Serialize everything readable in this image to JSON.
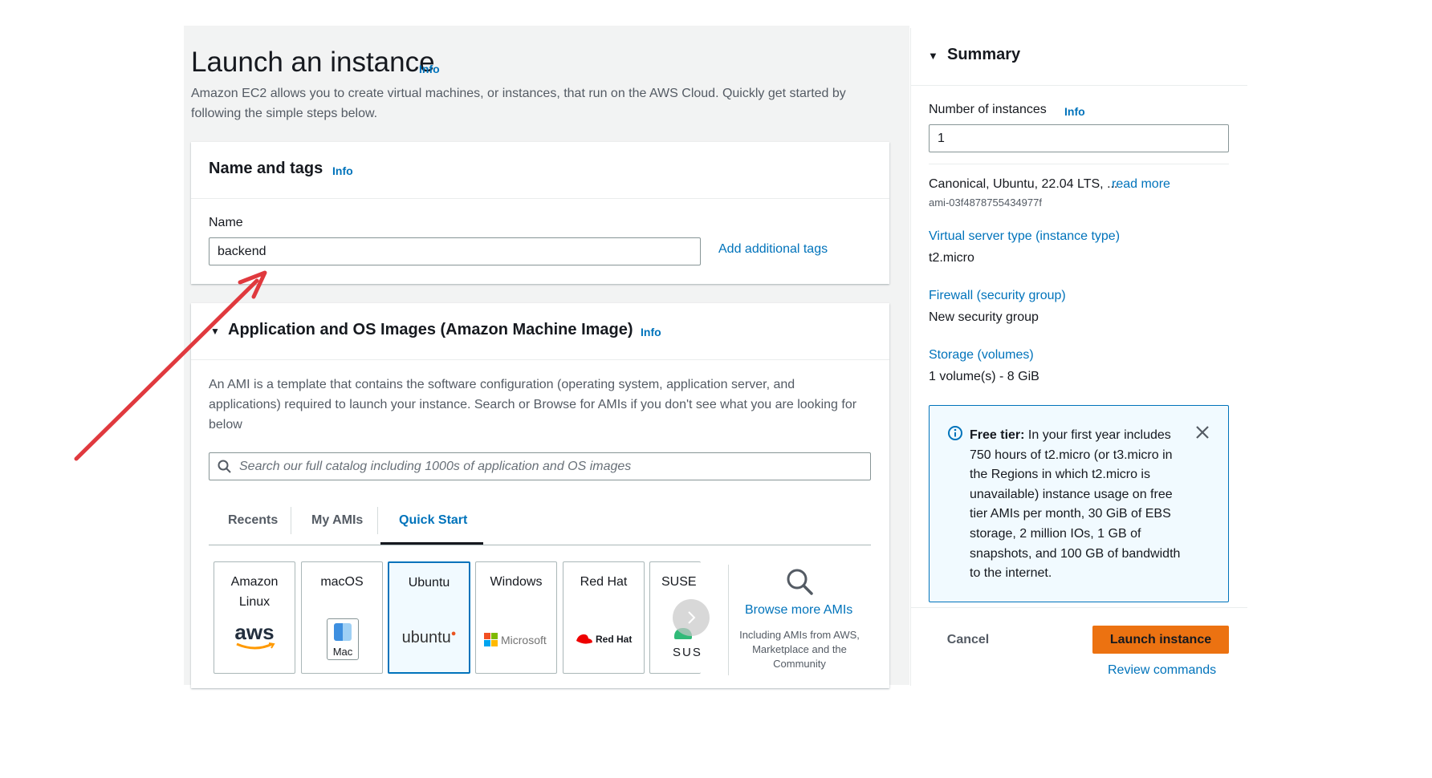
{
  "header": {
    "title": "Launch an instance",
    "info": "Info",
    "description": "Amazon EC2 allows you to create virtual machines, or instances, that run on the AWS Cloud. Quickly get started by following the simple steps below."
  },
  "name_tags": {
    "title": "Name and tags",
    "info": "Info",
    "name_label": "Name",
    "name_value": "backend",
    "add_tags_link": "Add additional tags"
  },
  "ami": {
    "title": "Application and OS Images (Amazon Machine Image)",
    "info": "Info",
    "description": "An AMI is a template that contains the software configuration (operating system, application server, and applications) required to launch your instance. Search or Browse for AMIs if you don't see what you are looking for below",
    "search_placeholder": "Search our full catalog including 1000s of application and OS images",
    "tabs": [
      "Recents",
      "My AMIs",
      "Quick Start"
    ],
    "active_tab": "Quick Start",
    "cards": [
      {
        "name": "Amazon Linux",
        "logo": "aws"
      },
      {
        "name": "macOS",
        "logo": "Mac"
      },
      {
        "name": "Ubuntu",
        "logo": "ubuntu"
      },
      {
        "name": "Windows",
        "logo": "Microsoft"
      },
      {
        "name": "Red Hat",
        "logo": "Red Hat"
      },
      {
        "name": "SUSE Li",
        "logo": "SUS"
      }
    ],
    "selected_card": "Ubuntu",
    "browse_more": "Browse more AMIs",
    "browse_sub": "Including AMIs from AWS, Marketplace and the Community"
  },
  "summary": {
    "title": "Summary",
    "num_instances_label": "Number of instances",
    "info": "Info",
    "num_instances_value": "1",
    "ami_text": "Canonical, Ubuntu, 22.04 LTS, ...",
    "read_more": "read more",
    "ami_id": "ami-03f4878755434977f",
    "instance_type_label": "Virtual server type (instance type)",
    "instance_type_value": "t2.micro",
    "firewall_label": "Firewall (security group)",
    "firewall_value": "New security group",
    "storage_label": "Storage (volumes)",
    "storage_value": "1 volume(s) - 8 GiB",
    "free_tier_bold": "Free tier:",
    "free_tier_text": " In your first year includes 750 hours of t2.micro (or t3.micro in the Regions in which t2.micro is unavailable) instance usage on free tier AMIs per month, 30 GiB of EBS storage, 2 million IOs, 1 GB of snapshots, and 100 GB of bandwidth to the internet.",
    "cancel": "Cancel",
    "launch": "Launch instance",
    "review_commands": "Review commands"
  },
  "colors": {
    "link": "#0073bb",
    "primary_button": "#ec7211",
    "annotation_arrow": "#e0393e"
  }
}
